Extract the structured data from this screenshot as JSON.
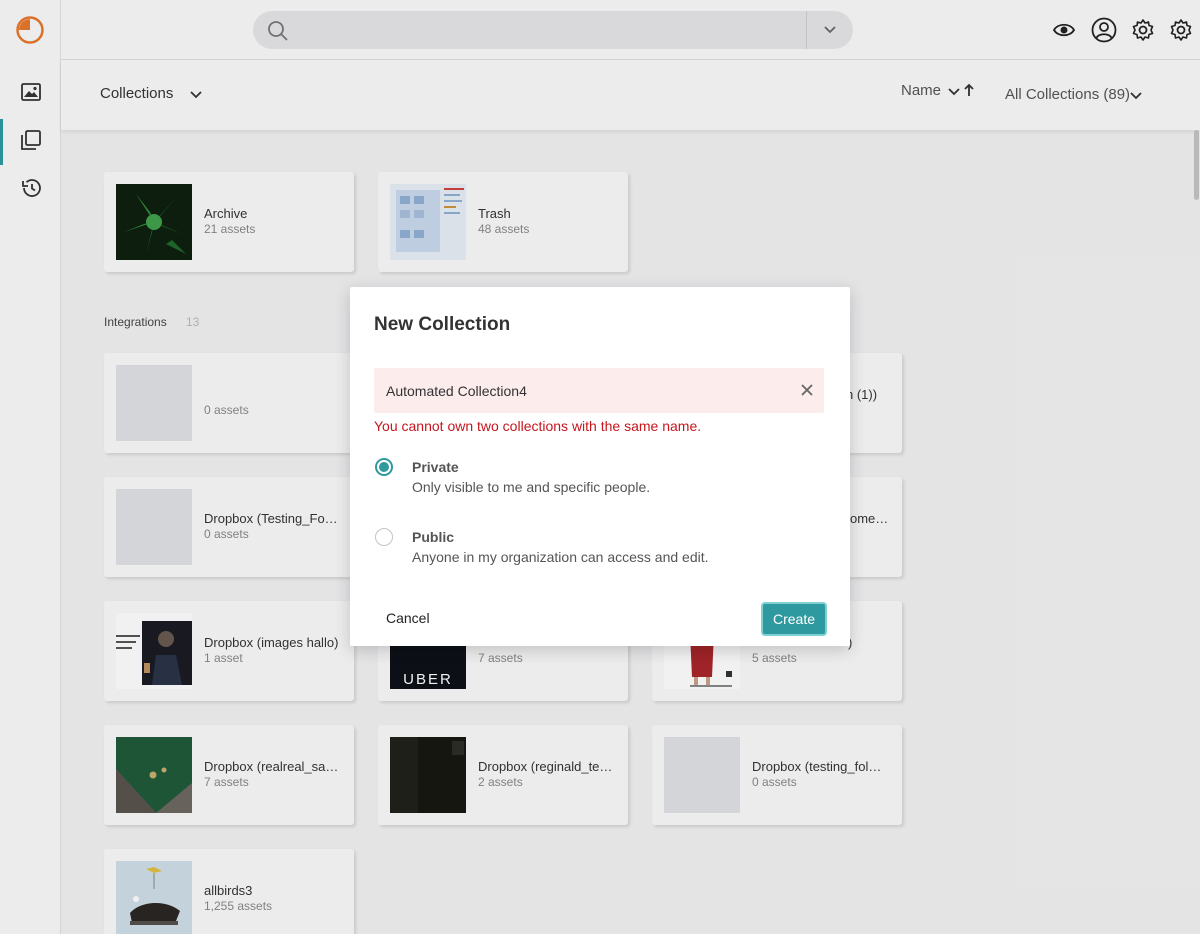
{
  "search": {
    "placeholder": ""
  },
  "subheader": {
    "title": "Collections",
    "sort_label": "Name",
    "filter_label": "All Collections (89)"
  },
  "top_cards": [
    {
      "name": "Archive",
      "count": "21 assets"
    },
    {
      "name": "Trash",
      "count": "48 assets"
    }
  ],
  "integrations": {
    "title": "Integrations",
    "count": "13",
    "cards": [
      {
        "name": "",
        "count": "0 assets"
      },
      {
        "name": "",
        "count": ""
      },
      {
        "name": "n (1))",
        "count": ""
      },
      {
        "name": "Dropbox (Testing_Fol…",
        "count": "0 assets"
      },
      {
        "name": "",
        "count": ""
      },
      {
        "name": "ome…",
        "count": ""
      },
      {
        "name": "Dropbox (images hallo)",
        "count": "1 asset"
      },
      {
        "name": "",
        "count": "7 assets"
      },
      {
        "name": ")",
        "count": "5 assets"
      },
      {
        "name": "Dropbox (realreal_sa…",
        "count": "7 assets"
      },
      {
        "name": "Dropbox (reginald_te…",
        "count": "2 assets"
      },
      {
        "name": "Dropbox (testing_fol…",
        "count": "0 assets"
      },
      {
        "name": "allbirds3",
        "count": "1,255 assets"
      }
    ]
  },
  "thumb_texts": {
    "uber": "UBER"
  },
  "modal": {
    "title": "New Collection",
    "name_value": "Automated Collection4",
    "error": "You cannot own two collections with the same name.",
    "options": [
      {
        "title": "Private",
        "desc": "Only visible to me and specific people.",
        "selected": true
      },
      {
        "title": "Public",
        "desc": "Anyone in my organization can access and edit.",
        "selected": false
      }
    ],
    "cancel_label": "Cancel",
    "create_label": "Create"
  },
  "colors": {
    "accent": "#2e9aa0",
    "error": "#c5161d",
    "error_bg": "#fcecec",
    "logo": "#e8782b"
  },
  "icons": [
    "logo-icon",
    "image-icon",
    "collections-icon",
    "history-icon",
    "search-icon",
    "chevron-down-icon",
    "eye-icon",
    "user-icon",
    "settings-icon",
    "admin-settings-icon",
    "sort-ascending-icon",
    "close-icon"
  ]
}
